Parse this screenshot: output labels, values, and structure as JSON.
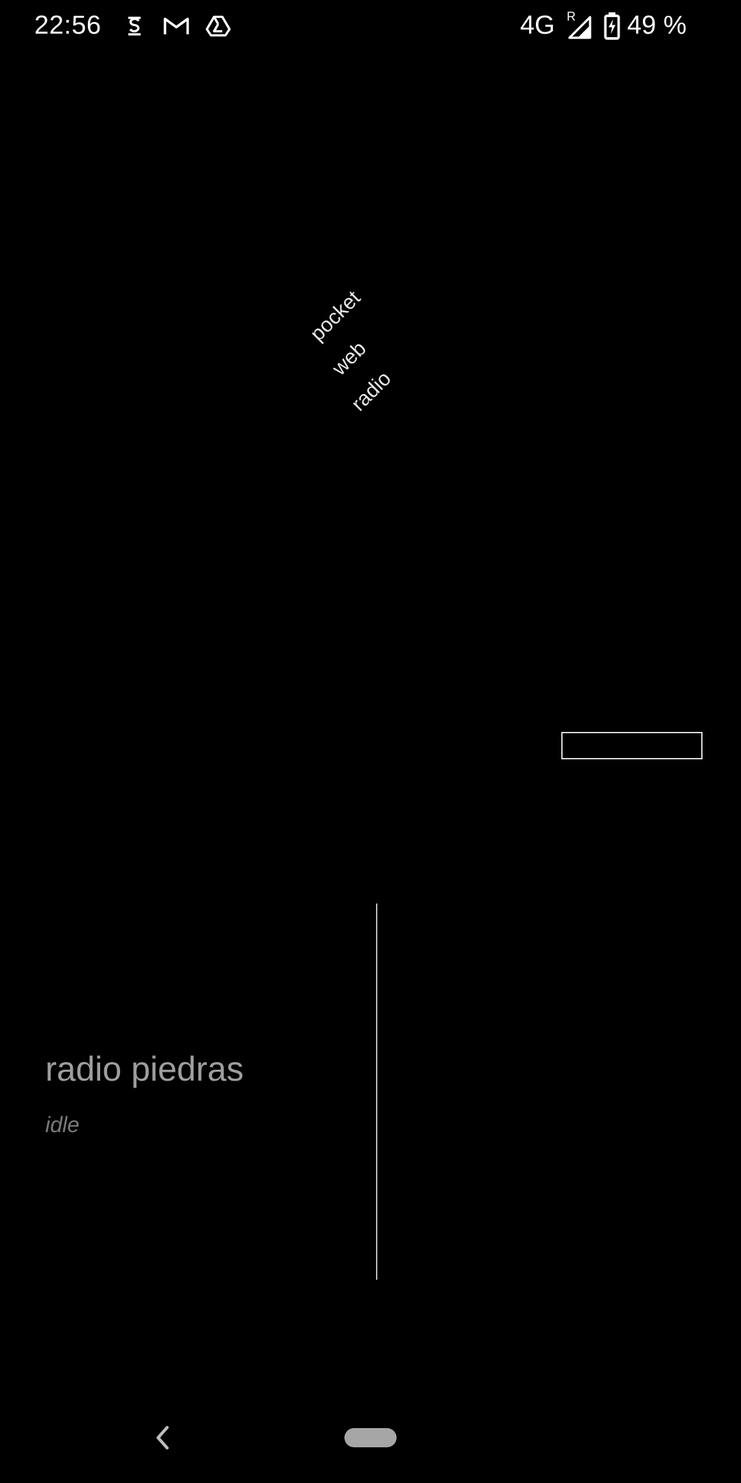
{
  "status_bar": {
    "time": "22:56",
    "left_icons": [
      "sim-icon",
      "gmail-icon",
      "drive-icon"
    ],
    "network": "4G",
    "roaming": "R",
    "battery_percent": "49 %",
    "battery_charging": true
  },
  "app": {
    "logo": {
      "line1": "pocket",
      "line2": "web",
      "line3": "radio"
    },
    "station": {
      "name": "radio piedras",
      "status": "idle"
    }
  },
  "colors": {
    "background": "#000000",
    "station_name": "#9e9e9e",
    "station_status": "#7a7a7a",
    "outline": "#d9d9d9"
  },
  "nav_bar": {
    "icons": [
      "back-icon",
      "home-pill"
    ]
  }
}
